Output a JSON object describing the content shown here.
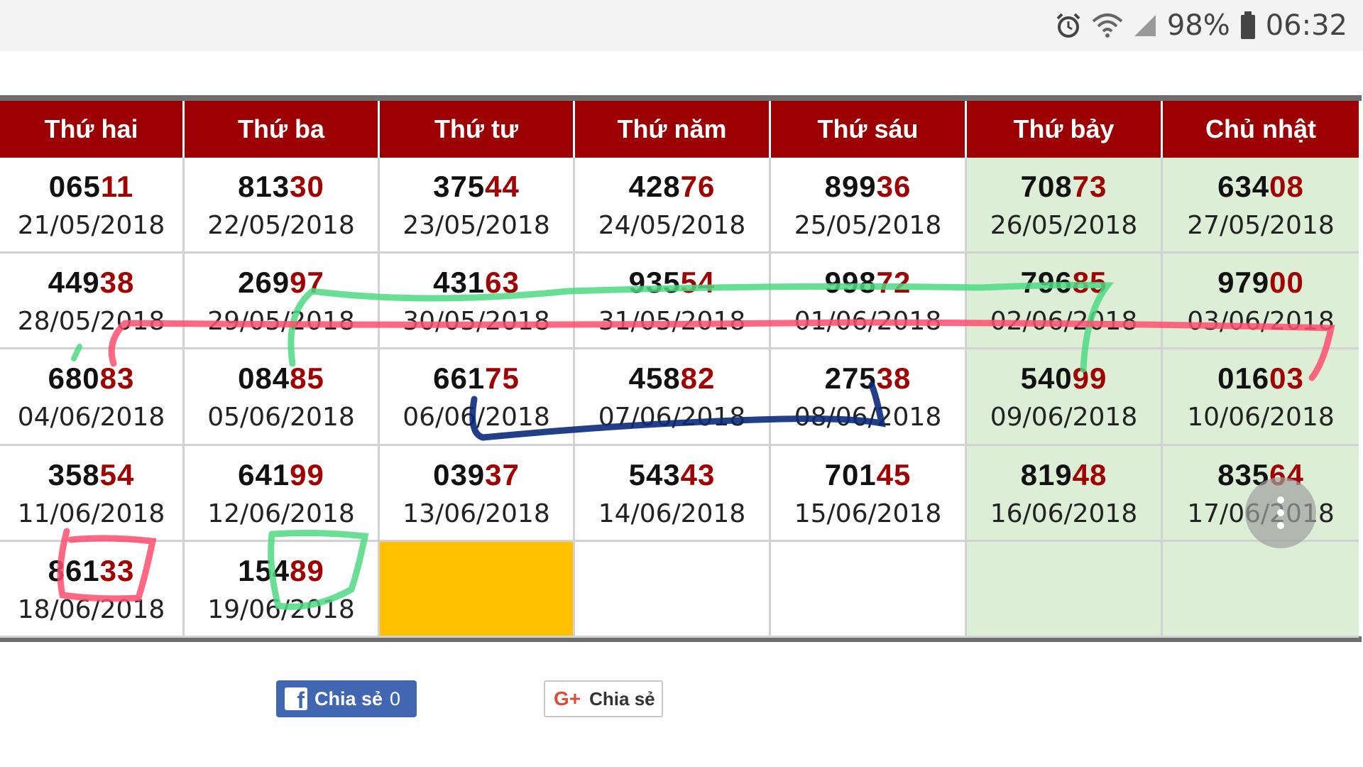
{
  "status_bar": {
    "battery_text": "98%",
    "time": "06:32",
    "icons": [
      "alarm-icon",
      "wifi-icon",
      "signal-icon",
      "battery-icon"
    ]
  },
  "calendar": {
    "headers": [
      "Thứ hai",
      "Thứ ba",
      "Thứ tư",
      "Thứ năm",
      "Thứ sáu",
      "Thứ bảy",
      "Chủ nhật"
    ],
    "rows": [
      [
        {
          "num_a": "065",
          "num_b": "11",
          "date": "21/05/2018"
        },
        {
          "num_a": "813",
          "num_b": "30",
          "date": "22/05/2018"
        },
        {
          "num_a": "375",
          "num_b": "44",
          "date": "23/05/2018"
        },
        {
          "num_a": "428",
          "num_b": "76",
          "date": "24/05/2018"
        },
        {
          "num_a": "899",
          "num_b": "36",
          "date": "25/05/2018"
        },
        {
          "num_a": "708",
          "num_b": "73",
          "date": "26/05/2018"
        },
        {
          "num_a": "634",
          "num_b": "08",
          "date": "27/05/2018"
        }
      ],
      [
        {
          "num_a": "449",
          "num_b": "38",
          "date": "28/05/2018"
        },
        {
          "num_a": "269",
          "num_b": "97",
          "date": "29/05/2018"
        },
        {
          "num_a": "431",
          "num_b": "63",
          "date": "30/05/2018"
        },
        {
          "num_a": "935",
          "num_b": "54",
          "date": "31/05/2018"
        },
        {
          "num_a": "998",
          "num_b": "72",
          "date": "01/06/2018"
        },
        {
          "num_a": "796",
          "num_b": "85",
          "date": "02/06/2018"
        },
        {
          "num_a": "979",
          "num_b": "00",
          "date": "03/06/2018"
        }
      ],
      [
        {
          "num_a": "680",
          "num_b": "83",
          "date": "04/06/2018"
        },
        {
          "num_a": "084",
          "num_b": "85",
          "date": "05/06/2018"
        },
        {
          "num_a": "661",
          "num_b": "75",
          "date": "06/06/2018"
        },
        {
          "num_a": "458",
          "num_b": "82",
          "date": "07/06/2018"
        },
        {
          "num_a": "275",
          "num_b": "38",
          "date": "08/06/2018"
        },
        {
          "num_a": "540",
          "num_b": "99",
          "date": "09/06/2018"
        },
        {
          "num_a": "016",
          "num_b": "03",
          "date": "10/06/2018"
        }
      ],
      [
        {
          "num_a": "358",
          "num_b": "54",
          "date": "11/06/2018"
        },
        {
          "num_a": "641",
          "num_b": "99",
          "date": "12/06/2018"
        },
        {
          "num_a": "039",
          "num_b": "37",
          "date": "13/06/2018"
        },
        {
          "num_a": "543",
          "num_b": "43",
          "date": "14/06/2018"
        },
        {
          "num_a": "701",
          "num_b": "45",
          "date": "15/06/2018"
        },
        {
          "num_a": "819",
          "num_b": "48",
          "date": "16/06/2018"
        },
        {
          "num_a": "835",
          "num_b": "64",
          "date": "17/06/2018"
        }
      ],
      [
        {
          "num_a": "861",
          "num_b": "33",
          "date": "18/06/2018"
        },
        {
          "num_a": "154",
          "num_b": "89",
          "date": "19/06/2018"
        },
        {
          "num_a": "",
          "num_b": "",
          "date": ""
        },
        {
          "num_a": "",
          "num_b": "",
          "date": ""
        },
        {
          "num_a": "",
          "num_b": "",
          "date": ""
        },
        {
          "num_a": "",
          "num_b": "",
          "date": ""
        },
        {
          "num_a": "",
          "num_b": "",
          "date": ""
        }
      ]
    ]
  },
  "share": {
    "facebook_label": "Chia sẻ",
    "facebook_count": "0",
    "google_label": "Chia sẻ",
    "google_logo": "G+"
  },
  "colors": {
    "header_bg": "#9c0002",
    "highlight_digits": "#a00000",
    "weekend_bg": "#dcefd6",
    "pending_cell": "#ffc000",
    "facebook": "#4267b2"
  }
}
